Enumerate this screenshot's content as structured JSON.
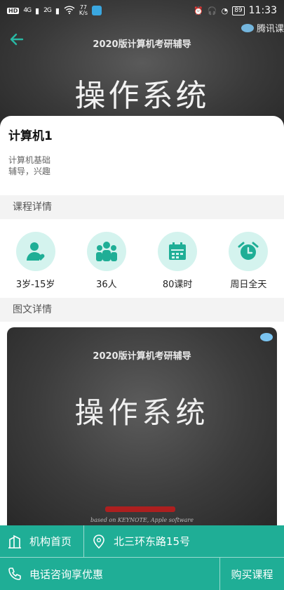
{
  "status_bar": {
    "hd": "HD",
    "sig1": "4G",
    "sig2": "2G",
    "speed_value": "77",
    "speed_unit": "K/s",
    "battery": "89",
    "time": "11:33"
  },
  "hero": {
    "subtitle": "2020版计算机考研辅导",
    "title": "操作系统",
    "watermark": "腾讯课"
  },
  "course": {
    "name": "计算机1",
    "description": "计算机基础\n辅导，兴趣"
  },
  "sections": {
    "details": "课程详情",
    "image_details": "图文详情"
  },
  "stats": [
    {
      "icon": "person-heart-icon",
      "label": "3岁-15岁"
    },
    {
      "icon": "group-icon",
      "label": "36人"
    },
    {
      "icon": "calendar-icon",
      "label": "80课时"
    },
    {
      "icon": "alarm-clock-icon",
      "label": "周日全天"
    }
  ],
  "detail_image": {
    "subtitle": "2020版计算机考研辅导",
    "title": "操作系统",
    "footer": "based on KEYNOTE, Apple software"
  },
  "bottom_bar": {
    "home": "机构首页",
    "address": "北三环东路15号",
    "phone": "电话咨询享优惠",
    "buy": "购买课程"
  },
  "colors": {
    "accent": "#1fae96",
    "icon_bg": "#d4f3ee",
    "icon_fg": "#1fae96"
  }
}
